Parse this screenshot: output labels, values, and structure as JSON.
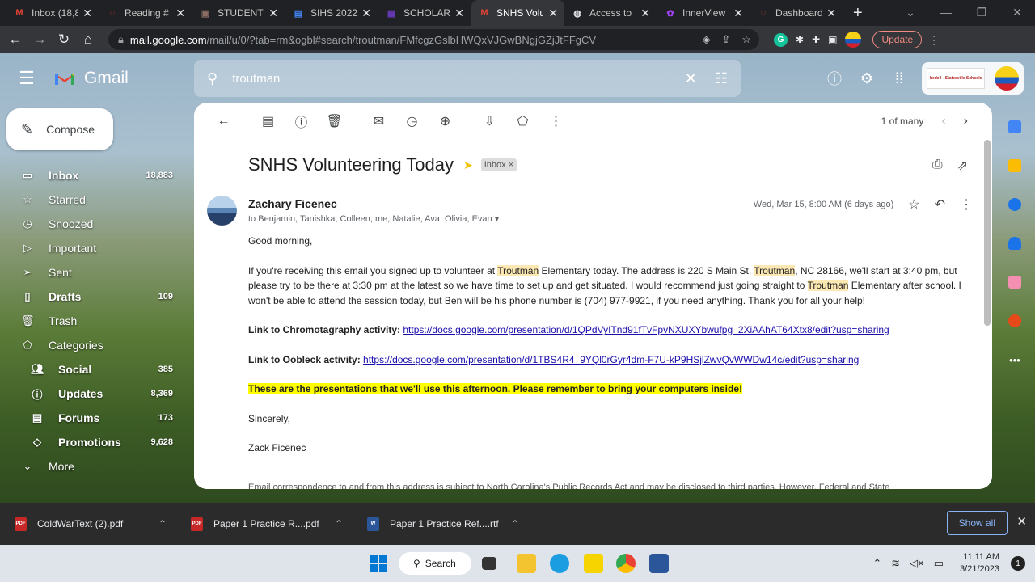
{
  "browser": {
    "tabs": [
      {
        "title": "Inbox (18,8",
        "icon": "gmail-icon",
        "color": "#ea4335"
      },
      {
        "title": "Reading #",
        "icon": "loading-icon",
        "color": "#e53935"
      },
      {
        "title": "STUDENT",
        "icon": "student-icon",
        "color": "#8d6e63"
      },
      {
        "title": "SIHS 2022",
        "icon": "docs-icon",
        "color": "#4285f4"
      },
      {
        "title": "SCHOLARS",
        "icon": "forms-icon",
        "color": "#673ab7"
      },
      {
        "title": "SNHS Volu",
        "icon": "gmail-icon",
        "color": "#ea4335",
        "active": true
      },
      {
        "title": "Access to",
        "icon": "globe-icon",
        "color": "#e8eaed"
      },
      {
        "title": "InnerView",
        "icon": "innerview-icon",
        "color": "#a142f4"
      },
      {
        "title": "Dashboard",
        "icon": "loading-icon",
        "color": "#e53935"
      }
    ],
    "url_host": "mail.google.com",
    "url_path": "/mail/u/0/?tab=rm&ogbl#search/troutman/FMfcgzGslbHWQxVJGwBNgjGZjJtFFgCV",
    "update_label": "Update"
  },
  "gmail": {
    "brand": "Gmail",
    "search_value": "troutman",
    "account_org": "Iredell - Statesville Schools",
    "compose_label": "Compose",
    "sidebar": [
      {
        "label": "Inbox",
        "count": "18,883",
        "bold": true,
        "icon": "inbox-icon",
        "active": true
      },
      {
        "label": "Starred",
        "count": "",
        "bold": false,
        "icon": "star-icon"
      },
      {
        "label": "Snoozed",
        "count": "",
        "bold": false,
        "icon": "clock-icon"
      },
      {
        "label": "Important",
        "count": "",
        "bold": false,
        "icon": "important-icon"
      },
      {
        "label": "Sent",
        "count": "",
        "bold": false,
        "icon": "send-icon"
      },
      {
        "label": "Drafts",
        "count": "109",
        "bold": true,
        "icon": "draft-icon"
      },
      {
        "label": "Trash",
        "count": "",
        "bold": false,
        "icon": "trash-icon"
      },
      {
        "label": "Categories",
        "count": "",
        "bold": false,
        "icon": "label-icon"
      },
      {
        "label": "Social",
        "count": "385",
        "bold": true,
        "icon": "people-icon",
        "sub": true
      },
      {
        "label": "Updates",
        "count": "8,369",
        "bold": true,
        "icon": "info-icon",
        "sub": true
      },
      {
        "label": "Forums",
        "count": "173",
        "bold": true,
        "icon": "forum-icon",
        "sub": true
      },
      {
        "label": "Promotions",
        "count": "9,628",
        "bold": true,
        "icon": "tag-icon",
        "sub": true
      },
      {
        "label": "More",
        "count": "",
        "bold": false,
        "icon": "chevron-down-icon"
      }
    ],
    "pager_text": "1 of many",
    "email": {
      "subject": "SNHS Volunteering Today",
      "label": "Inbox",
      "label_close": "×",
      "sender": "Zachary Ficenec",
      "recipients": "to Benjamin, Tanishka, Colleen, me, Natalie, Ava, Olivia, Evan",
      "date": "Wed, Mar 15, 8:00 AM (6 days ago)",
      "greeting": "Good morning,",
      "p1_a": "If you're receiving this email you signed up to volunteer at ",
      "kw": "Troutman",
      "p1_b": " Elementary today. The address is 220 S Main St, ",
      "p1_c": ", NC 28166, we'll start at 3:40 pm, but please try to be there at 3:30 pm at the latest so we have time to set up and get situated. I would recommend just going straight to ",
      "p1_d": " Elementary after school. I won't be able to attend the session today, but Ben will be his phone number is (704) 977-9921, if you need anything. Thank you for all your help!",
      "link1_label": "Link to Chromotagraphy activity:",
      "link1_url": "https://docs.google.com/presentation/d/1QPdVyITnd91fTvFpvNXUXYbwufpg_2XiAAhAT64Xtx8/edit?usp=sharing",
      "link2_label": "Link to Oobleck activity:",
      "link2_url": "https://docs.google.com/presentation/d/1TBS4R4_9YQl0rGyr4dm-F7U-kP9HSjlZwvQvWWDw14c/edit?usp=sharing",
      "highlight_note": "These are the presentations that we'll use this afternoon. Please remember to bring your computers inside!",
      "closing": "Sincerely,",
      "signature": "Zack Ficenec",
      "footer": "Email correspondence to and from this address is subject to North Carolina's Public Records Act and may be disclosed to third parties. However, Federal and State"
    }
  },
  "downloads": {
    "items": [
      {
        "name": "ColdWarText (2).pdf",
        "type": "PDF"
      },
      {
        "name": "Paper 1 Practice R....pdf",
        "type": "PDF"
      },
      {
        "name": "Paper 1 Practice Ref....rtf",
        "type": "W"
      }
    ],
    "show_all": "Show all"
  },
  "taskbar": {
    "search_label": "Search",
    "time": "11:11 AM",
    "date": "3/21/2023",
    "notifications": "1"
  }
}
